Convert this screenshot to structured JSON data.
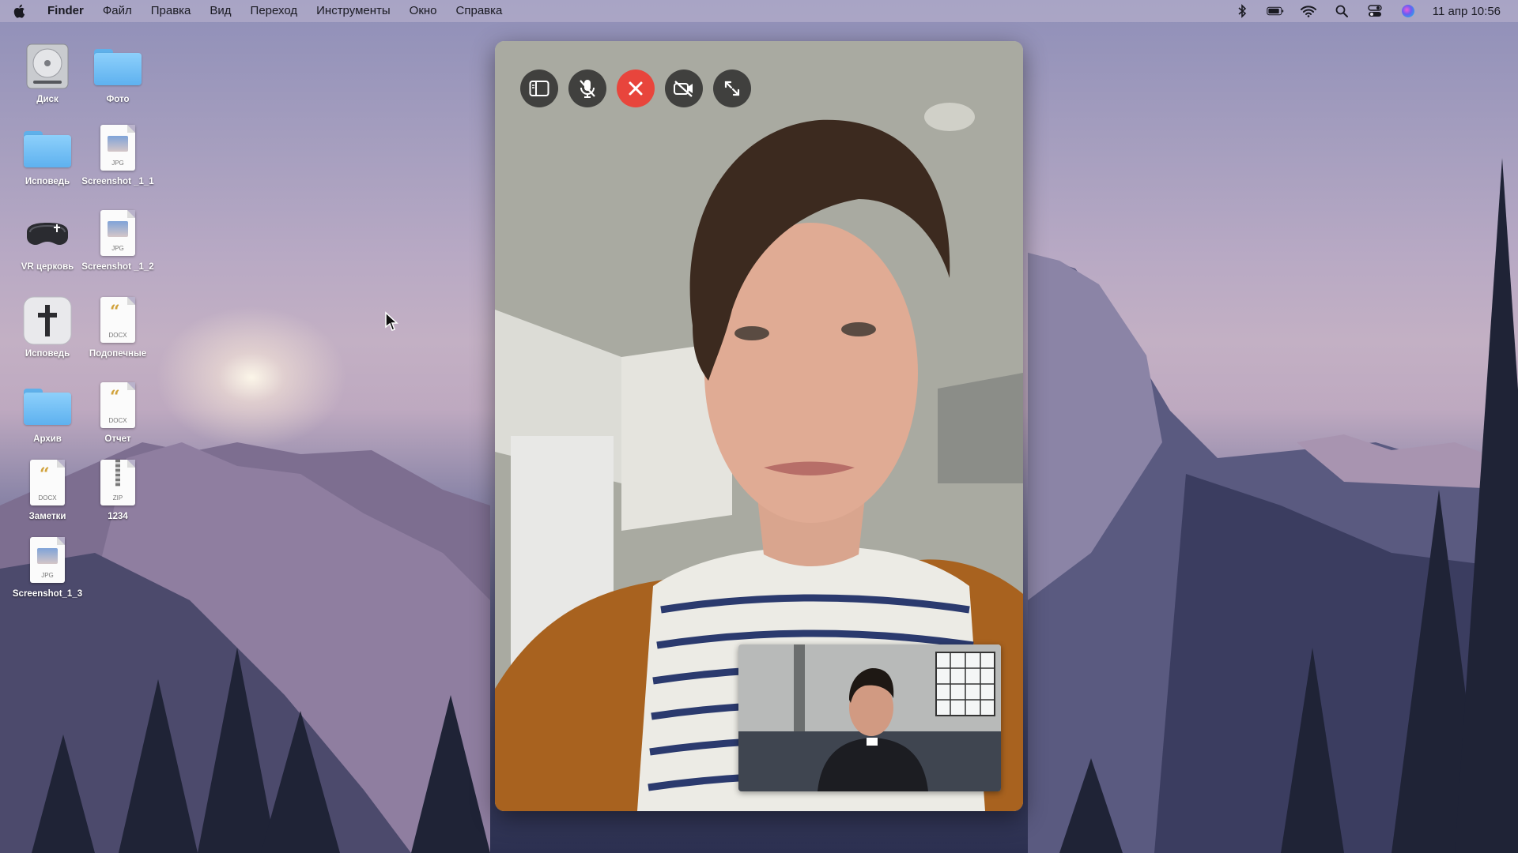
{
  "menubar": {
    "app_name": "Finder",
    "items": [
      "Файл",
      "Правка",
      "Вид",
      "Переход",
      "Инструменты",
      "Окно",
      "Справка"
    ],
    "clock": "11 апр 10:56",
    "status_icons": [
      "bluetooth-icon",
      "battery-icon",
      "wifi-icon",
      "search-icon",
      "control-center-icon",
      "siri-icon"
    ]
  },
  "desktop": {
    "icons": [
      {
        "label": "Диск",
        "kind": "disk"
      },
      {
        "label": "Фото",
        "kind": "folder"
      },
      {
        "label": "Исповедь",
        "kind": "folder"
      },
      {
        "label": "Screenshot _1_1",
        "kind": "jpg",
        "ext": "JPG"
      },
      {
        "label": "VR церковь",
        "kind": "vr-headset"
      },
      {
        "label": "Screenshot _1_2",
        "kind": "jpg",
        "ext": "JPG"
      },
      {
        "label": "Исповедь",
        "kind": "cross-app"
      },
      {
        "label": "Подопечные",
        "kind": "docx",
        "ext": "DOCX"
      },
      {
        "label": "Архив",
        "kind": "folder"
      },
      {
        "label": "Отчет",
        "kind": "docx",
        "ext": "DOCX"
      },
      {
        "label": "Заметки",
        "kind": "docx",
        "ext": "DOCX"
      },
      {
        "label": "1234",
        "kind": "zip",
        "ext": "ZIP"
      },
      {
        "label": "Screenshot_1_3",
        "kind": "jpg",
        "ext": "JPG"
      }
    ]
  },
  "call": {
    "controls": [
      {
        "name": "sidebar-toggle-icon"
      },
      {
        "name": "mute-microphone-icon"
      },
      {
        "name": "end-call-icon"
      },
      {
        "name": "camera-off-icon"
      },
      {
        "name": "fullscreen-icon"
      }
    ],
    "colors": {
      "end_call": "#e8453c",
      "control_bg": "#282828"
    }
  }
}
